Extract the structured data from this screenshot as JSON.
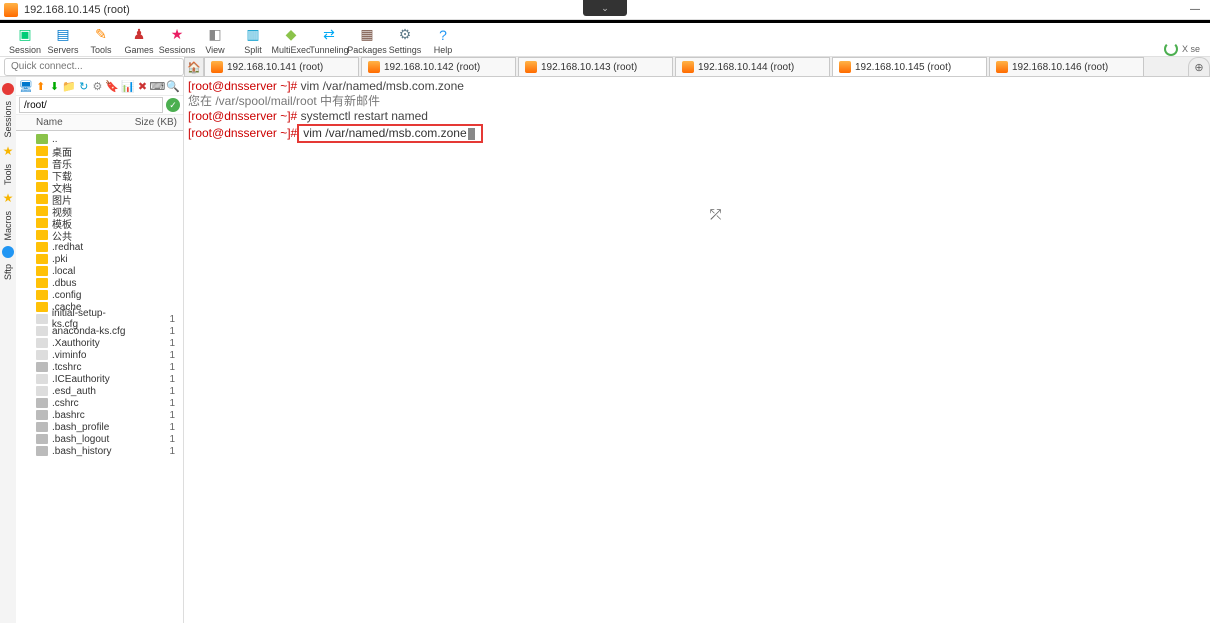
{
  "window": {
    "title": "192.168.10.145 (root)"
  },
  "dropdown_mid": "⌄",
  "win_buttons": {
    "min": "—",
    "close": ""
  },
  "toolbar": {
    "items": [
      {
        "label": "Session",
        "glyph": "▣",
        "cls": "ic-term"
      },
      {
        "label": "Servers",
        "glyph": "▤",
        "cls": "ic-srv"
      },
      {
        "label": "Tools",
        "glyph": "✎",
        "cls": "ic-tool"
      },
      {
        "label": "Games",
        "glyph": "♟",
        "cls": "ic-game"
      },
      {
        "label": "Sessions",
        "glyph": "★",
        "cls": "ic-sess"
      },
      {
        "label": "View",
        "glyph": "◧",
        "cls": "ic-view"
      },
      {
        "label": "Split",
        "glyph": "▥",
        "cls": "ic-split"
      },
      {
        "label": "MultiExec",
        "glyph": "◆",
        "cls": "ic-multi"
      },
      {
        "label": "Tunneling",
        "glyph": "⇄",
        "cls": "ic-tun"
      },
      {
        "label": "Packages",
        "glyph": "▦",
        "cls": "ic-pkg"
      },
      {
        "label": "Settings",
        "glyph": "⚙",
        "cls": "ic-set"
      },
      {
        "label": "Help",
        "glyph": "?",
        "cls": "ic-help"
      }
    ],
    "right": "X se"
  },
  "quickconnect": {
    "placeholder": "Quick connect..."
  },
  "tabs": {
    "items": [
      {
        "label": "192.168.10.141 (root)"
      },
      {
        "label": "192.168.10.142 (root)"
      },
      {
        "label": "192.168.10.143 (root)"
      },
      {
        "label": "192.168.10.144 (root)"
      },
      {
        "label": "192.168.10.145 (root)",
        "active": true
      },
      {
        "label": "192.168.10.146 (root)"
      }
    ],
    "add": "⊕"
  },
  "leftrail": {
    "items": [
      {
        "label": "Sessions"
      },
      {
        "label": "Tools"
      },
      {
        "label": "Macros"
      },
      {
        "label": "Sftp"
      }
    ]
  },
  "sidebar": {
    "mini_icons": [
      "🖥",
      "⬆",
      "⬇",
      "📁",
      "↻",
      "⚙",
      "🔖",
      "📊",
      "✖",
      "⌨",
      "🔍"
    ],
    "path": "/root/",
    "headers": {
      "name": "Name",
      "size": "Size (KB)"
    },
    "up": "..",
    "items": [
      {
        "name": "桌面",
        "type": "folder"
      },
      {
        "name": "音乐",
        "type": "folder"
      },
      {
        "name": "下载",
        "type": "folder"
      },
      {
        "name": "文档",
        "type": "folder"
      },
      {
        "name": "图片",
        "type": "folder"
      },
      {
        "name": "视频",
        "type": "folder"
      },
      {
        "name": "模板",
        "type": "folder"
      },
      {
        "name": "公共",
        "type": "folder"
      },
      {
        "name": ".redhat",
        "type": "folder"
      },
      {
        "name": ".pki",
        "type": "folder"
      },
      {
        "name": ".local",
        "type": "folder"
      },
      {
        "name": ".dbus",
        "type": "folder"
      },
      {
        "name": ".config",
        "type": "folder"
      },
      {
        "name": ".cache",
        "type": "folder"
      },
      {
        "name": "initial-setup-ks.cfg",
        "type": "file",
        "size": "1"
      },
      {
        "name": "anaconda-ks.cfg",
        "type": "file",
        "size": "1"
      },
      {
        "name": ".Xauthority",
        "type": "file",
        "size": "1"
      },
      {
        "name": ".viminfo",
        "type": "file",
        "size": "1"
      },
      {
        "name": ".tcshrc",
        "type": "gray",
        "size": "1"
      },
      {
        "name": ".ICEauthority",
        "type": "file",
        "size": "1"
      },
      {
        "name": ".esd_auth",
        "type": "file",
        "size": "1"
      },
      {
        "name": ".cshrc",
        "type": "gray",
        "size": "1"
      },
      {
        "name": ".bashrc",
        "type": "gray",
        "size": "1"
      },
      {
        "name": ".bash_profile",
        "type": "gray",
        "size": "1"
      },
      {
        "name": ".bash_logout",
        "type": "gray",
        "size": "1"
      },
      {
        "name": ".bash_history",
        "type": "gray",
        "size": "1"
      }
    ]
  },
  "terminal": {
    "lines": [
      {
        "prompt": "[root@dnsserver ~]#",
        "cmd": " vim /var/named/msb.com.zone"
      },
      {
        "plain": "您在 /var/spool/mail/root 中有新邮件"
      },
      {
        "prompt": "[root@dnsserver ~]#",
        "cmd": " systemctl restart named"
      },
      {
        "prompt": "[root@dnsserver ~]#",
        "highlight": " vim /var/named/msb.com.zone"
      }
    ],
    "cursor_glyph": "⤱"
  }
}
